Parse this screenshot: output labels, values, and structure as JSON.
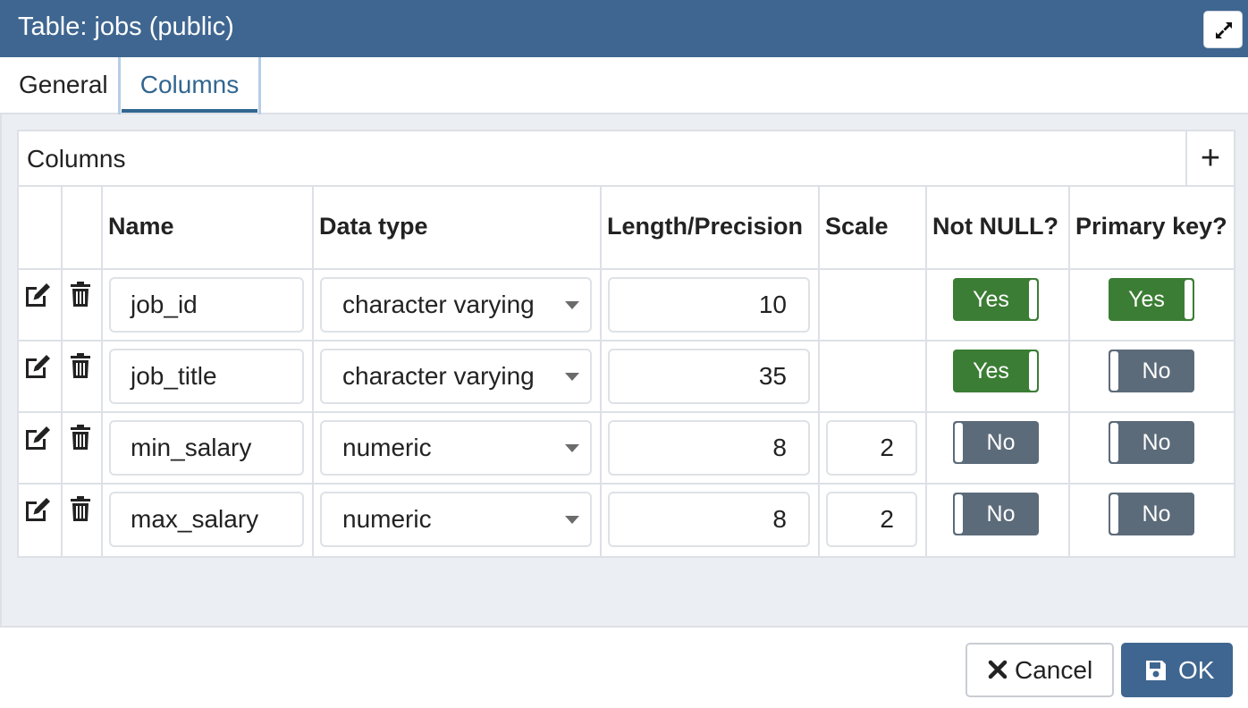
{
  "dialog": {
    "title": "Table: jobs (public)",
    "maximize_icon": "expand-arrows-icon"
  },
  "tabs": [
    {
      "label": "General",
      "active": false
    },
    {
      "label": "Columns",
      "active": true
    }
  ],
  "columns_panel": {
    "title": "Columns",
    "add_label": "+",
    "headers": {
      "name": "Name",
      "data_type": "Data type",
      "length": "Length/Precision",
      "scale": "Scale",
      "not_null": "Not NULL?",
      "primary_key": "Primary key?"
    },
    "rows": [
      {
        "name": "job_id",
        "data_type": "character varying",
        "length": "10",
        "scale": "",
        "not_null": "Yes",
        "primary_key": "Yes"
      },
      {
        "name": "job_title",
        "data_type": "character varying",
        "length": "35",
        "scale": "",
        "not_null": "Yes",
        "primary_key": "No"
      },
      {
        "name": "min_salary",
        "data_type": "numeric",
        "length": "8",
        "scale": "2",
        "not_null": "No",
        "primary_key": "No"
      },
      {
        "name": "max_salary",
        "data_type": "numeric",
        "length": "8",
        "scale": "2",
        "not_null": "No",
        "primary_key": "No"
      }
    ]
  },
  "footer": {
    "cancel_label": "Cancel",
    "ok_label": "OK"
  },
  "colors": {
    "header_bg": "#3f6690",
    "toggle_yes": "#3b7d34",
    "toggle_no": "#5c6b7a",
    "active_tab": "#326690"
  }
}
